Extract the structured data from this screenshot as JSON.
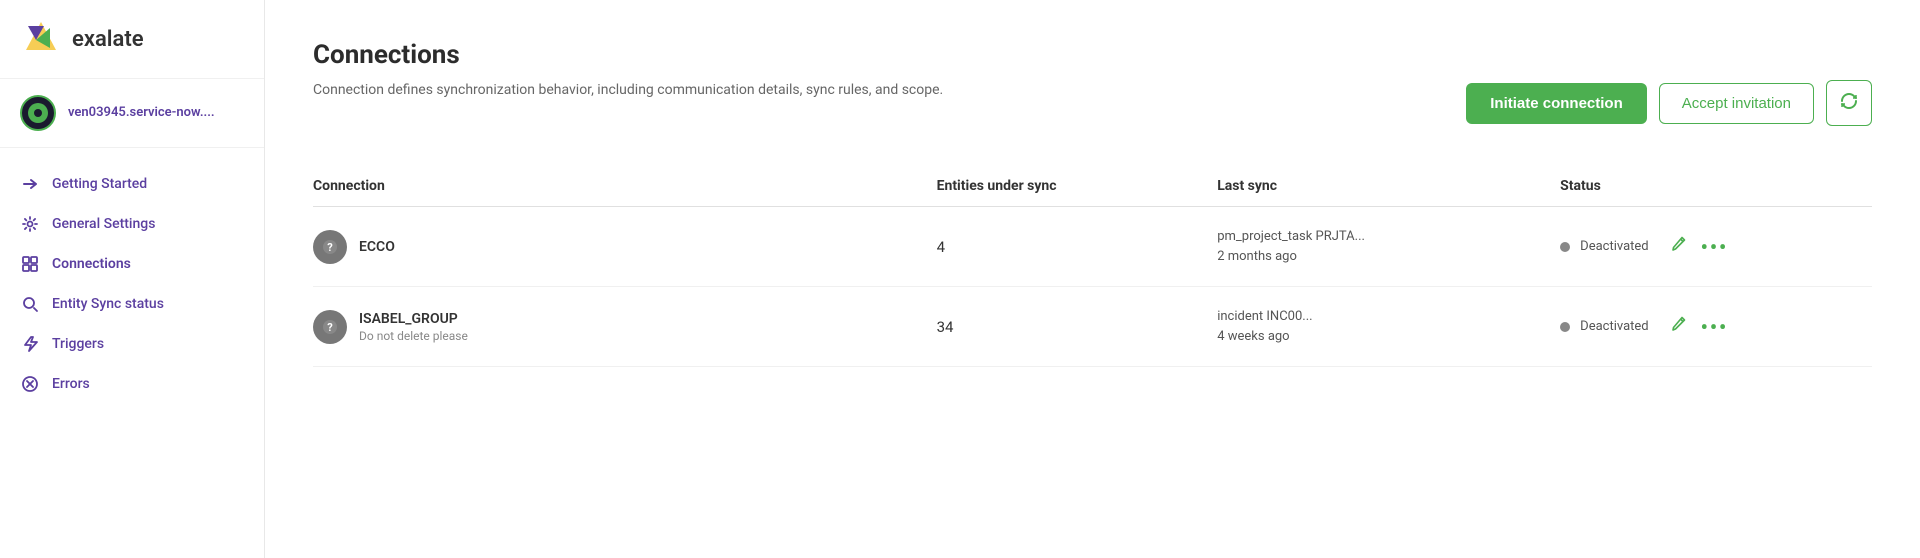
{
  "sidebar": {
    "logo_text": "exalate",
    "account_name": "ven03945.service-now....",
    "nav_items": [
      {
        "id": "getting-started",
        "label": "Getting Started",
        "icon": "arrow-right"
      },
      {
        "id": "general-settings",
        "label": "General Settings",
        "icon": "gear"
      },
      {
        "id": "connections",
        "label": "Connections",
        "icon": "grid"
      },
      {
        "id": "entity-sync-status",
        "label": "Entity Sync status",
        "icon": "search"
      },
      {
        "id": "triggers",
        "label": "Triggers",
        "icon": "lightning"
      },
      {
        "id": "errors",
        "label": "Errors",
        "icon": "x-circle"
      }
    ]
  },
  "main": {
    "page_title": "Connections",
    "page_description": "Connection defines synchronization behavior, including communication details, sync rules, and scope.",
    "buttons": {
      "initiate": "Initiate connection",
      "accept": "Accept invitation",
      "refresh_icon": "↻"
    },
    "table": {
      "columns": [
        "Connection",
        "Entities under sync",
        "Last sync",
        "Status"
      ],
      "rows": [
        {
          "name": "ECCO",
          "sub": "",
          "entities": "4",
          "last_sync_line1": "pm_project_task PRJTA...",
          "last_sync_line2": "2 months ago",
          "status": "Deactivated"
        },
        {
          "name": "ISABEL_GROUP",
          "sub": "Do not delete please",
          "entities": "34",
          "last_sync_line1": "incident INC00...",
          "last_sync_line2": "4 weeks ago",
          "status": "Deactivated"
        }
      ]
    }
  }
}
